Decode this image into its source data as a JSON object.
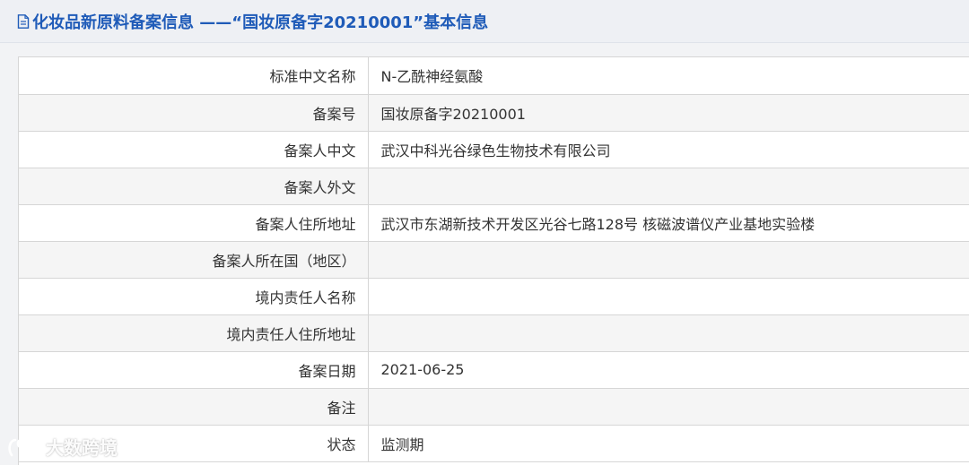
{
  "header": {
    "title": "化妆品新原料备案信息 ——“国妆原备字20210001”基本信息"
  },
  "rows": [
    {
      "label": "标准中文名称",
      "value": "N-乙酰神经氨酸"
    },
    {
      "label": "备案号",
      "value": "国妆原备字20210001"
    },
    {
      "label": "备案人中文",
      "value": "武汉中科光谷绿色生物技术有限公司"
    },
    {
      "label": "备案人外文",
      "value": ""
    },
    {
      "label": "备案人住所地址",
      "value": "武汉市东湖新技术开发区光谷七路128号 核磁波谱仪产业基地实验楼"
    },
    {
      "label": "备案人所在国（地区）",
      "value": ""
    },
    {
      "label": "境内责任人名称",
      "value": ""
    },
    {
      "label": "境内责任人住所地址",
      "value": ""
    },
    {
      "label": "备案日期",
      "value": "2021-06-25"
    },
    {
      "label": "备注",
      "value": ""
    },
    {
      "label": "状态",
      "value": "监测期"
    }
  ],
  "watermark": {
    "text": "大数跨境"
  }
}
